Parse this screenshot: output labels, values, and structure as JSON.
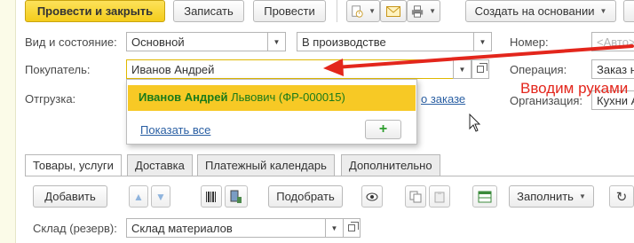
{
  "toolbar": {
    "post_close": "Провести и закрыть",
    "save": "Записать",
    "post": "Провести",
    "create_based_on": "Создать на основании"
  },
  "header": {
    "kind_label": "Вид и состояние:",
    "kind_value": "Основной",
    "state_value": "В производстве",
    "number_label": "Номер:",
    "number_placeholder": "<Авто>",
    "buyer_label": "Покупатель:",
    "buyer_value": "Иванов Андрей",
    "operation_label": "Операция:",
    "operation_value": "Заказ н",
    "shipment_label": "Отгрузка:",
    "order_link": "о заказе",
    "org_label": "Организация:",
    "org_value": "Кухни А"
  },
  "dropdown": {
    "item_bold": "Иванов Андрей",
    "item_rest": " Львович (ФР-000015)",
    "show_all": "Показать все",
    "add_symbol": "+"
  },
  "annotation": {
    "text": "Вводим руками",
    "color": "#e3261c"
  },
  "tabs": [
    {
      "label": "Товары, услуги",
      "active": true
    },
    {
      "label": "Доставка"
    },
    {
      "label": "Платежный календарь"
    },
    {
      "label": "Дополнительно"
    }
  ],
  "items_toolbar": {
    "add": "Добавить",
    "pick": "Подобрать",
    "fill": "Заполнить"
  },
  "warehouse": {
    "label": "Склад (резерв):",
    "value": "Склад материалов"
  },
  "colors": {
    "accent_yellow": "#f7c925",
    "link_blue": "#2a5fa3",
    "green": "#1a7a1a"
  }
}
